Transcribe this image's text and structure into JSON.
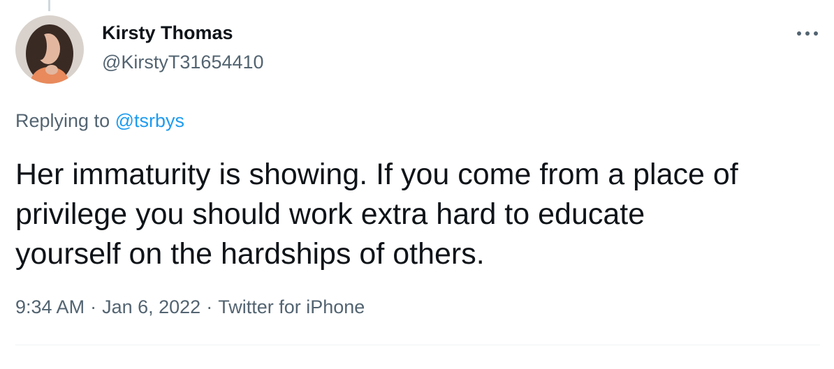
{
  "author": {
    "name": "Kirsty Thomas",
    "handle": "@KirstyT31654410"
  },
  "reply": {
    "prefix": "Replying to",
    "mention": "@tsrbys"
  },
  "tweet": {
    "lines": [
      "Her immaturity is showing. If you come from a place of",
      "privilege you should work extra hard to educate",
      "yourself on the hardships of others."
    ]
  },
  "meta": {
    "time": "9:34 AM",
    "separator": "·",
    "date": "Jan 6, 2022",
    "source": "Twitter for iPhone"
  },
  "icons": {
    "more": "more-horizontal-icon"
  },
  "colors": {
    "text": "#0f1419",
    "secondary": "#536471",
    "link": "#1d9bf0",
    "divider": "#eff3f4"
  }
}
